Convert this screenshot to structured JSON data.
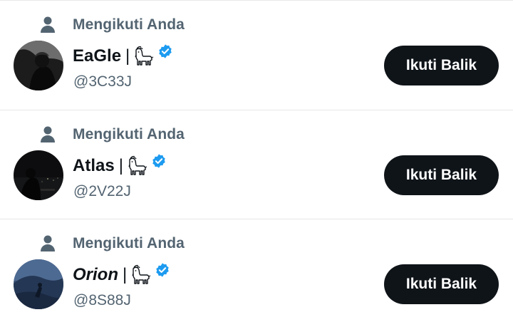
{
  "accounts": [
    {
      "context_label": "Mengikuti Anda",
      "context_icon": "person-icon",
      "display_name": "EaGle",
      "separator": "|",
      "name_emoji": "goat-icon",
      "verified_badge": "verified-badge-icon",
      "handle": "@3C33J",
      "follow_back_label": "Ikuti Balik",
      "name_italic": false
    },
    {
      "context_label": "Mengikuti Anda",
      "context_icon": "person-icon",
      "display_name": "Atlas",
      "separator": "|",
      "name_emoji": "goat-icon",
      "verified_badge": "verified-badge-icon",
      "handle": "@2V22J",
      "follow_back_label": "Ikuti Balik",
      "name_italic": false
    },
    {
      "context_label": "Mengikuti Anda",
      "context_icon": "person-icon",
      "display_name": "Orion",
      "separator": "|",
      "name_emoji": "goat-icon",
      "verified_badge": "verified-badge-icon",
      "handle": "@8S88J",
      "follow_back_label": "Ikuti Balik",
      "name_italic": true
    }
  ],
  "colors": {
    "text_primary": "#0f1419",
    "text_secondary": "#536471",
    "verified_blue": "#1d9bf0",
    "button_bg": "#0f1419",
    "button_text": "#ffffff",
    "divider": "#e6e8ea"
  }
}
